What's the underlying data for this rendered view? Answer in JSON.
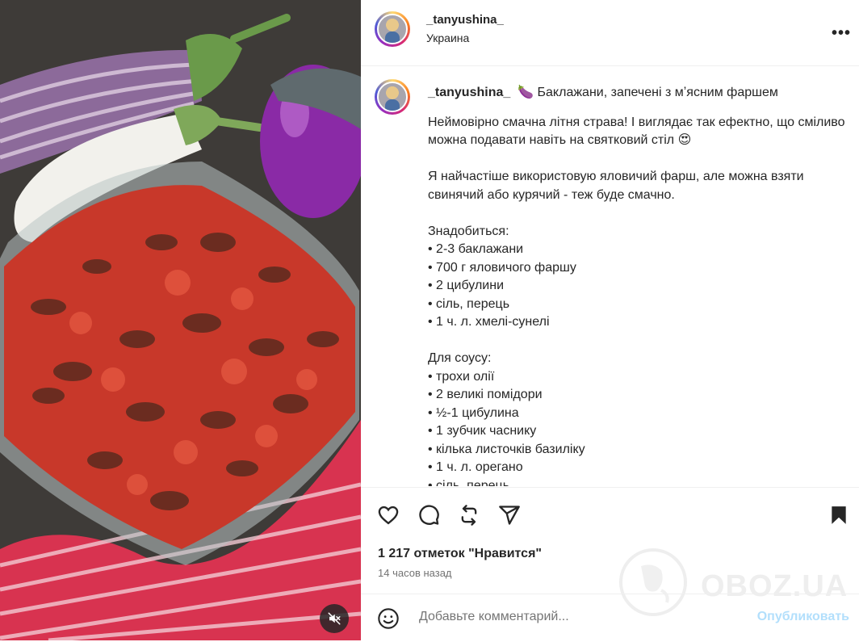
{
  "post": {
    "username": "_tanyushina_",
    "location": "Украина",
    "caption_title": "🍆 Баклажани, запечені з мʼясним фаршем",
    "caption_body": "Неймовірно смачна літня страва! І виглядає так ефектно, що сміливо можна подавати навіть на святковий стіл 😍\n\nЯ найчастіше використовую яловичий фарш, але можна взяти свинячий або курячий - теж буде смачно.\n\nЗнадобиться:\n• 2-3 баклажани\n• 700 г яловичого фаршу\n• 2 цибулини\n• сіль, перець\n• 1 ч. л. хмелі-сунелі\n\nДля соусу:\n• трохи олії\n• 2 великі помідори\n• ½-1 цибулина\n• 1 зубчик часнику\n• кілька листочків базиліку\n• 1 ч. л. орегано\n• сіль, перець",
    "likes": "1 217 отметок \"Нравится\"",
    "time_ago": "14 часов назад",
    "comment_placeholder": "Добавьте комментарий...",
    "publish_label": "Опубликовать",
    "more_label": "•••"
  },
  "watermark": {
    "text": "OBOZ.UA"
  },
  "colors": {
    "accent": "#0095f6",
    "publish_disabled": "#b2dffc",
    "text": "#262626",
    "secondary": "#737373"
  }
}
